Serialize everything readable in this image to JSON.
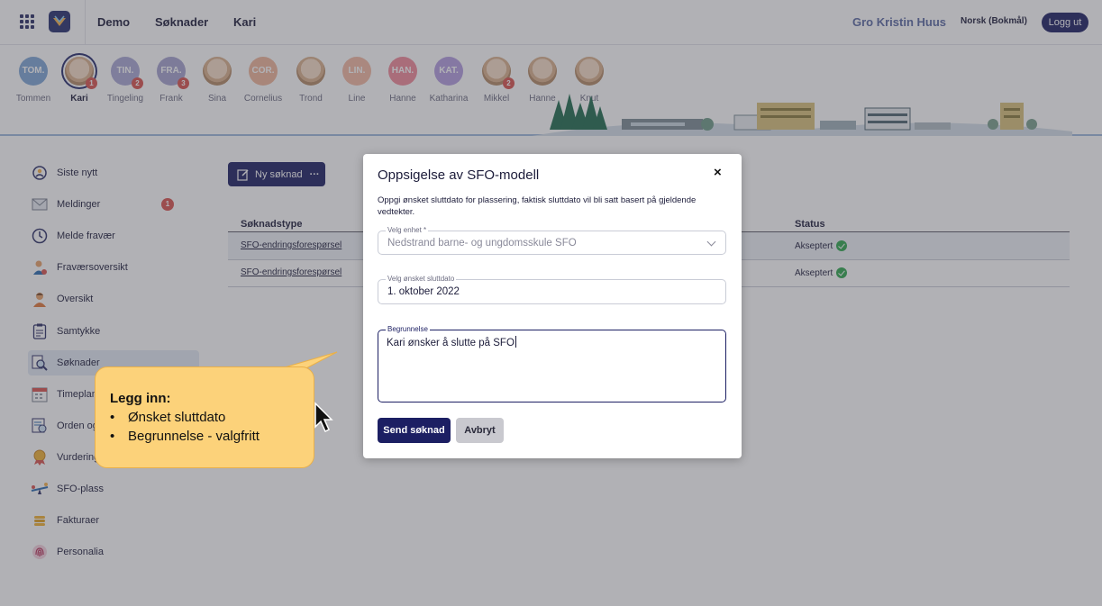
{
  "header": {
    "crumbs": [
      "Demo",
      "Søknader",
      "Kari"
    ],
    "user_name": "Gro Kristin Huus",
    "language": "Norsk (Bokmål)",
    "logout_label": "Logg ut"
  },
  "children": [
    {
      "name": "Tommen",
      "initials": "TOM.",
      "color": "#7fa6d6"
    },
    {
      "name": "Kari",
      "photo": true,
      "selected": true,
      "count": "1"
    },
    {
      "name": "Tingeling",
      "initials": "TIN.",
      "color": "#a9a7d4",
      "count": "2"
    },
    {
      "name": "Frank",
      "initials": "FRA.",
      "color": "#a5a3cf",
      "count": "3"
    },
    {
      "name": "Sina",
      "photo": true
    },
    {
      "name": "Cornelius",
      "initials": "COR.",
      "color": "#f0b69a"
    },
    {
      "name": "Trond",
      "photo": true
    },
    {
      "name": "Line",
      "initials": "LIN.",
      "color": "#f3b9a2"
    },
    {
      "name": "Hanne",
      "initials": "HAN.",
      "color": "#f28a9a"
    },
    {
      "name": "Katharina",
      "initials": "KAT.",
      "color": "#b39ee0"
    },
    {
      "name": "Mikkel",
      "photo": true,
      "count": "2"
    },
    {
      "name": "Hanne",
      "photo": true
    },
    {
      "name": "Knut",
      "photo": true
    }
  ],
  "sidebar": {
    "items": [
      {
        "label": "Siste nytt",
        "icon": "news-icon"
      },
      {
        "label": "Meldinger",
        "icon": "envelope-icon",
        "badge": "1"
      },
      {
        "label": "Melde fravær",
        "icon": "clock-icon"
      },
      {
        "label": "Fraværsoversikt",
        "icon": "person-absence-icon"
      },
      {
        "label": "Oversikt",
        "icon": "person-icon"
      },
      {
        "label": "Samtykke",
        "icon": "clipboard-icon"
      },
      {
        "label": "Søknader",
        "icon": "search-document-icon",
        "active": true
      },
      {
        "label": "Timeplan",
        "icon": "calendar-icon"
      },
      {
        "label": "Orden og a",
        "icon": "report-icon"
      },
      {
        "label": "Vurdering",
        "icon": "medal-icon"
      },
      {
        "label": "SFO-plass",
        "icon": "seesaw-icon"
      },
      {
        "label": "Fakturaer",
        "icon": "coins-icon"
      },
      {
        "label": "Personalia",
        "icon": "fingerprint-icon"
      }
    ]
  },
  "main": {
    "new_button_label": "Ny søknad",
    "new_button_more": "···",
    "columns": {
      "type": "Søknadstype",
      "status": "Status"
    },
    "rows": [
      {
        "type": "SFO-endringsforespørsel",
        "status": "Akseptert"
      },
      {
        "type": "SFO-endringsforespørsel",
        "status": "Akseptert"
      }
    ]
  },
  "modal": {
    "title": "Oppsigelse av SFO-modell",
    "close": "×",
    "description": "Oppgi ønsket sluttdato for plassering, faktisk sluttdato vil bli satt basert på gjeldende vedtekter.",
    "unit": {
      "label": "Velg enhet *",
      "value": "Nedstrand barne- og ungdomsskule SFO"
    },
    "end_date": {
      "label": "Velg ønsket sluttdato",
      "value": "1. oktober 2022"
    },
    "reason": {
      "label": "Begrunnelse",
      "value": "Kari ønsker å slutte på SFO"
    },
    "send_label": "Send søknad",
    "cancel_label": "Avbryt"
  },
  "callout": {
    "heading": "Legg inn:",
    "bullet": "•",
    "items": [
      "Ønsket sluttdato",
      "Begrunnelse - valgfritt"
    ]
  },
  "colors": {
    "primary": "#1c1f63",
    "badge": "#d9534f",
    "success": "#2fa84f",
    "callout": "#fcd27a"
  }
}
